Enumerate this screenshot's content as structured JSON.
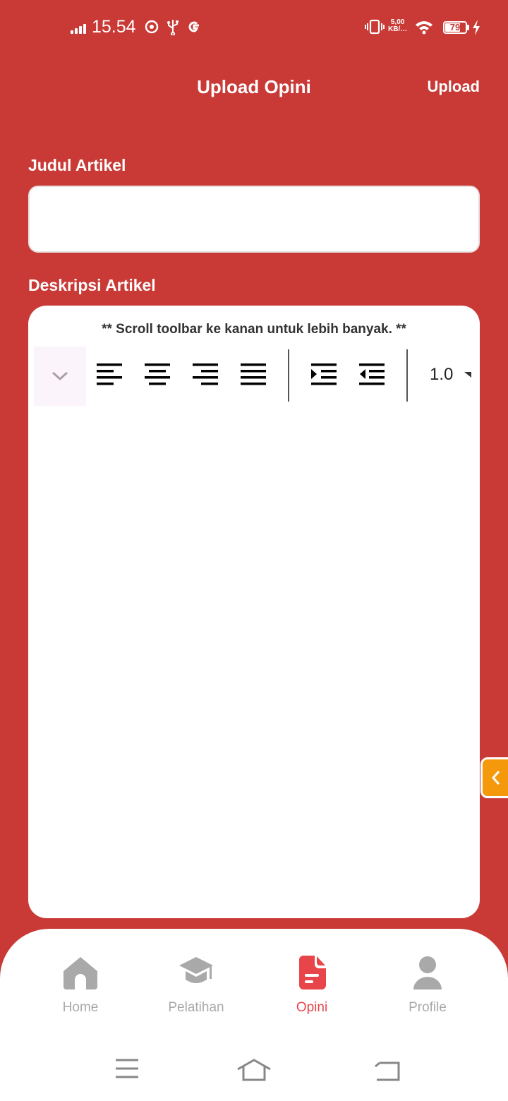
{
  "status_bar": {
    "time": "15.54",
    "net_speed_top": "5,00",
    "net_speed_bottom": "KB/…",
    "battery": "79"
  },
  "header": {
    "title": "Upload Opini",
    "upload_label": "Upload"
  },
  "form": {
    "title_label": "Judul Artikel",
    "title_value": "",
    "description_label": "Deskripsi Artikel",
    "toolbar_hint": "** Scroll toolbar ke kanan untuk lebih banyak. **",
    "line_height": "1.0"
  },
  "bottom_nav": {
    "items": [
      {
        "label": "Home",
        "icon": "home-icon"
      },
      {
        "label": "Pelatihan",
        "icon": "graduation-cap-icon"
      },
      {
        "label": "Opini",
        "icon": "document-icon",
        "active": true
      },
      {
        "label": "Profile",
        "icon": "person-icon"
      }
    ]
  },
  "colors": {
    "background": "#C93A36",
    "accent": "#E8454A",
    "side_tab": "#F5990C",
    "inactive": "#A9A9A9"
  }
}
